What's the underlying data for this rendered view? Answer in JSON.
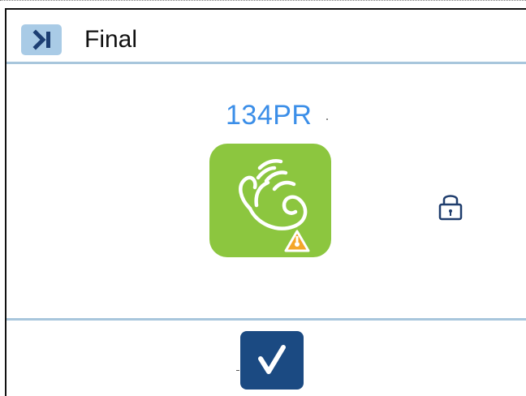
{
  "header": {
    "title": "Final",
    "skip_icon": "skip-to-end-icon"
  },
  "main": {
    "code": "134PR",
    "app_icon": "contactless-hand-warning-icon",
    "lock_icon": "padlock-icon"
  },
  "footer": {
    "confirm_icon": "checkmark-icon"
  },
  "colors": {
    "accent_blue": "#3b8ee8",
    "divider": "#a8c6dc",
    "skip_bg": "#a9cbe6",
    "skip_fg": "#1d3f73",
    "tile_green": "#8cc63f",
    "warn_orange": "#f4a62a",
    "lock_color": "#1f3d6d",
    "confirm_bg": "#1b4a82"
  }
}
